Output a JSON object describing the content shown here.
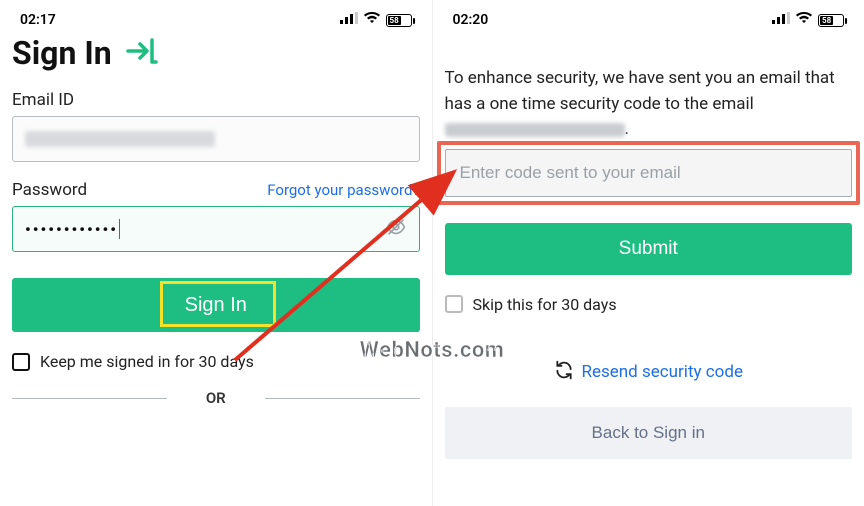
{
  "left": {
    "status": {
      "time": "02:17",
      "battery": "58"
    },
    "title": "Sign In",
    "email_label": "Email ID",
    "password_label": "Password",
    "forgot_link": "Forgot your password?",
    "password_dots": "••••••••••••",
    "signin_btn": "Sign In",
    "keep_signed_label": "Keep me signed in for 30 days",
    "or_text": "OR"
  },
  "right": {
    "status": {
      "time": "02:20",
      "battery": "58"
    },
    "desc_prefix": "To enhance security, we have sent you an email that has a one time security code to the email ",
    "desc_suffix": ".",
    "code_placeholder": "Enter code sent to your email",
    "submit_btn": "Submit",
    "skip_label": "Skip this for 30 days",
    "resend_label": "Resend security code",
    "back_btn": "Back to Sign in"
  },
  "watermark": "WebNots.com"
}
